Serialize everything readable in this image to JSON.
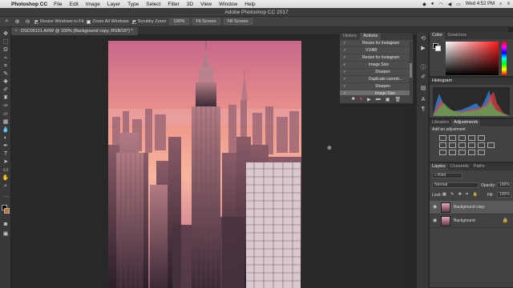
{
  "menubar": {
    "app_name": "Photoshop CC",
    "items": [
      "File",
      "Edit",
      "Image",
      "Layer",
      "Type",
      "Select",
      "Filter",
      "3D",
      "View",
      "Window",
      "Help"
    ],
    "clock": "Wed 4:52 PM"
  },
  "window": {
    "title": "Adobe Photoshop CC 2017"
  },
  "options": {
    "resize_windows": "Resize Windows to Fit",
    "zoom_all": "Zoom All Windows",
    "scrubby_zoom": "Scrubby Zoom",
    "zoom_value": "100%",
    "fit_screen": "Fit Screen",
    "fill_screen": "Fill Screen"
  },
  "document": {
    "tab_label": "DSC05121.ARW @ 100% (Background copy, RGB/16*) *"
  },
  "actions_panel": {
    "tabs": [
      "History",
      "Actions"
    ],
    "rows": [
      {
        "label": "Resize for Instagram"
      },
      {
        "label": "V1080"
      },
      {
        "label": "Resize for Instagram"
      },
      {
        "label": "Image Size"
      },
      {
        "label": "Sharpen"
      },
      {
        "label": "Duplicate current..."
      },
      {
        "label": "Sharpen"
      },
      {
        "label": "Image Size"
      }
    ]
  },
  "color_panel": {
    "tabs": [
      "Color",
      "Swatches"
    ]
  },
  "histogram_panel": {
    "title": "Histogram"
  },
  "adjustments_panel": {
    "tabs": [
      "Libraries",
      "Adjustments"
    ],
    "subtitle": "Add an adjustment"
  },
  "layers_panel": {
    "tabs": [
      "Layers",
      "Channels",
      "Paths"
    ],
    "kind": "Kind",
    "blend_mode": "Normal",
    "opacity_label": "Opacity:",
    "opacity_value": "100%",
    "lock_label": "Lock:",
    "fill_label": "Fill:",
    "fill_value": "100%",
    "layers": [
      {
        "name": "Background copy"
      },
      {
        "name": "Background"
      }
    ]
  },
  "colors": {
    "accent": "#2b7fd6",
    "foreground": "#000000",
    "background": "#ffffff"
  }
}
